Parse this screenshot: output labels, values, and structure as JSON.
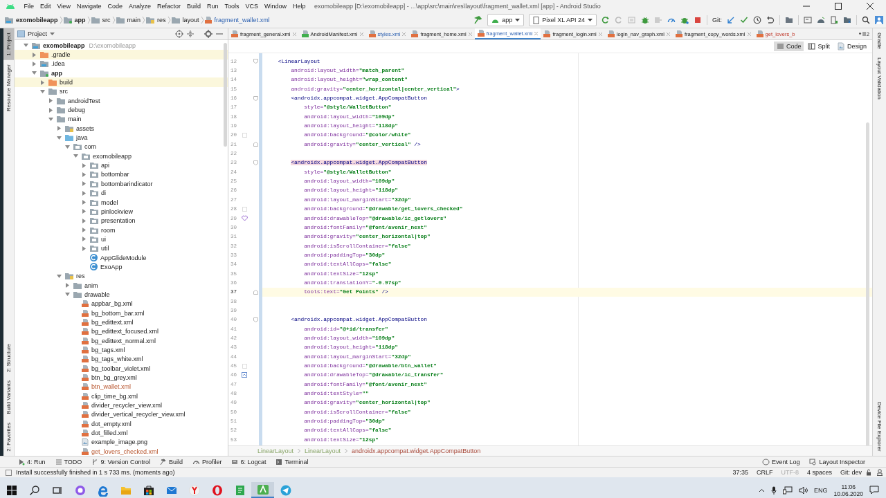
{
  "window": {
    "title": "exomobileapp [D:\\exomobileapp] - ...\\app\\src\\main\\res\\layout\\fragment_wallet.xml [app] - Android Studio"
  },
  "menu": [
    "File",
    "Edit",
    "View",
    "Navigate",
    "Code",
    "Analyze",
    "Refactor",
    "Build",
    "Run",
    "Tools",
    "VCS",
    "Window",
    "Help"
  ],
  "breadcrumbs": [
    {
      "label": "exomobileapp",
      "kind": "module"
    },
    {
      "label": "app",
      "kind": "app"
    },
    {
      "label": "src",
      "kind": "folder"
    },
    {
      "label": "main",
      "kind": "folder"
    },
    {
      "label": "res",
      "kind": "res"
    },
    {
      "label": "layout",
      "kind": "folder"
    },
    {
      "label": "fragment_wallet.xml",
      "kind": "xml"
    }
  ],
  "toolbar": {
    "run_config": "app",
    "device": "Pixel XL API 24",
    "git_label": "Git:"
  },
  "left_strip": {
    "top": [
      {
        "label": "1: Project",
        "selected": true
      },
      {
        "label": "Resource Manager",
        "selected": false
      }
    ],
    "bottom": [
      {
        "label": "2: Structure",
        "selected": false
      },
      {
        "label": "Build Variants",
        "selected": false
      },
      {
        "label": "2: Favorites",
        "selected": false
      }
    ]
  },
  "right_strip": {
    "top": [
      {
        "label": "Gradle"
      },
      {
        "label": "Layout Validation"
      }
    ],
    "bottom": [
      {
        "label": "Device File Explorer"
      }
    ]
  },
  "project_panel": {
    "title": "Project"
  },
  "project_tree": [
    {
      "label": "exomobileapp",
      "path": "D:\\exomobileapp",
      "kind": "module",
      "expanded": true,
      "children": [
        {
          "label": ".gradle",
          "kind": "excluded",
          "expanded": false
        },
        {
          "label": ".idea",
          "kind": "module",
          "expanded": false
        },
        {
          "label": "app",
          "kind": "app",
          "expanded": true,
          "children": [
            {
              "label": "build",
              "kind": "excluded",
              "expanded": false
            },
            {
              "label": "src",
              "kind": "folder",
              "expanded": true,
              "children": [
                {
                  "label": "androidTest",
                  "kind": "folder",
                  "expanded": false
                },
                {
                  "label": "debug",
                  "kind": "folder",
                  "expanded": false
                },
                {
                  "label": "main",
                  "kind": "folder",
                  "expanded": true,
                  "children": [
                    {
                      "label": "assets",
                      "kind": "res",
                      "expanded": false
                    },
                    {
                      "label": "java",
                      "kind": "source",
                      "expanded": true,
                      "children": [
                        {
                          "label": "com",
                          "kind": "package",
                          "expanded": true,
                          "children": [
                            {
                              "label": "exomobileapp",
                              "kind": "package",
                              "expanded": true,
                              "children": [
                                {
                                  "label": "api",
                                  "kind": "package",
                                  "expanded": false
                                },
                                {
                                  "label": "bottombar",
                                  "kind": "package",
                                  "expanded": false
                                },
                                {
                                  "label": "bottombarindicator",
                                  "kind": "package",
                                  "expanded": false
                                },
                                {
                                  "label": "di",
                                  "kind": "package",
                                  "expanded": false
                                },
                                {
                                  "label": "model",
                                  "kind": "package",
                                  "expanded": false
                                },
                                {
                                  "label": "pinlockview",
                                  "kind": "package",
                                  "expanded": false
                                },
                                {
                                  "label": "presentation",
                                  "kind": "package",
                                  "expanded": false
                                },
                                {
                                  "label": "room",
                                  "kind": "package",
                                  "expanded": false
                                },
                                {
                                  "label": "ui",
                                  "kind": "package",
                                  "expanded": false
                                },
                                {
                                  "label": "util",
                                  "kind": "package",
                                  "expanded": false
                                },
                                {
                                  "label": "AppGlideModule",
                                  "kind": "class"
                                },
                                {
                                  "label": "ExoApp",
                                  "kind": "class"
                                }
                              ]
                            }
                          ]
                        }
                      ]
                    },
                    {
                      "label": "res",
                      "kind": "res",
                      "expanded": true,
                      "children": [
                        {
                          "label": "anim",
                          "kind": "folder",
                          "expanded": false
                        },
                        {
                          "label": "drawable",
                          "kind": "folder",
                          "expanded": true,
                          "children": [
                            {
                              "label": "appbar_bg.xml",
                              "kind": "xml",
                              "changed": false
                            },
                            {
                              "label": "bg_bottom_bar.xml",
                              "kind": "xml",
                              "changed": false
                            },
                            {
                              "label": "bg_edittext.xml",
                              "kind": "xml",
                              "changed": false
                            },
                            {
                              "label": "bg_edittext_focused.xml",
                              "kind": "xml",
                              "changed": false
                            },
                            {
                              "label": "bg_edittext_normal.xml",
                              "kind": "xml",
                              "changed": false
                            },
                            {
                              "label": "bg_tags.xml",
                              "kind": "xml",
                              "changed": false
                            },
                            {
                              "label": "bg_tags_white.xml",
                              "kind": "xml",
                              "changed": false
                            },
                            {
                              "label": "bg_toolbar_violet.xml",
                              "kind": "xml",
                              "changed": false
                            },
                            {
                              "label": "btn_bg_grey.xml",
                              "kind": "xml",
                              "changed": false
                            },
                            {
                              "label": "btn_wallet.xml",
                              "kind": "xml",
                              "changed": true
                            },
                            {
                              "label": "clip_time_bg.xml",
                              "kind": "xml",
                              "changed": false
                            },
                            {
                              "label": "divider_recycler_view.xml",
                              "kind": "xml",
                              "changed": false
                            },
                            {
                              "label": "divider_vertical_recycler_view.xml",
                              "kind": "xml",
                              "changed": false
                            },
                            {
                              "label": "dot_empty.xml",
                              "kind": "xml",
                              "changed": false
                            },
                            {
                              "label": "dot_filled.xml",
                              "kind": "xml",
                              "changed": false
                            },
                            {
                              "label": "example_image.png",
                              "kind": "image",
                              "changed": false
                            },
                            {
                              "label": "get_lovers_checked.xml",
                              "kind": "xml",
                              "changed": true
                            }
                          ]
                        }
                      ]
                    }
                  ]
                }
              ]
            }
          ]
        }
      ]
    }
  ],
  "tabs": [
    {
      "label": "fragment_general.xml",
      "kind": "xml",
      "selected": false,
      "modified": false,
      "unversioned": false,
      "closable": true
    },
    {
      "label": "AndroidManifest.xml",
      "kind": "manifest",
      "selected": false,
      "modified": false,
      "unversioned": false,
      "closable": true
    },
    {
      "label": "styles.xml",
      "kind": "xml",
      "selected": false,
      "modified": true,
      "unversioned": false,
      "closable": true
    },
    {
      "label": "fragment_home.xml",
      "kind": "xml",
      "selected": false,
      "modified": false,
      "unversioned": false,
      "closable": true
    },
    {
      "label": "fragment_wallet.xml",
      "kind": "xml",
      "selected": true,
      "modified": true,
      "unversioned": false,
      "closable": true
    },
    {
      "label": "fragment_login.xml",
      "kind": "xml",
      "selected": false,
      "modified": false,
      "unversioned": false,
      "closable": true
    },
    {
      "label": "login_nav_graph.xml",
      "kind": "xml",
      "selected": false,
      "modified": false,
      "unversioned": false,
      "closable": true
    },
    {
      "label": "fragment_copy_words.xml",
      "kind": "xml",
      "selected": false,
      "modified": false,
      "unversioned": false,
      "closable": true
    },
    {
      "label": "get_lovers_b",
      "kind": "xml",
      "selected": false,
      "modified": false,
      "unversioned": true,
      "closable": false
    }
  ],
  "tabs_overflow": "2",
  "view_modes": [
    {
      "label": "Code",
      "kind": "lines",
      "selected": true
    },
    {
      "label": "Split",
      "kind": "split",
      "selected": false
    },
    {
      "label": "Design",
      "kind": "image",
      "selected": false
    }
  ],
  "code": [
    {
      "n": "12",
      "current": false,
      "kind": "fold-start",
      "tokens": [
        {
          "kind": "tag",
          "text": "<LinearLayout"
        }
      ],
      "children": [
        {
          "n": "13",
          "current": false,
          "kind": "plain",
          "tokens": [
            {
              "kind": "attr",
              "text": "android:layout_width="
            },
            {
              "kind": "val",
              "text": "\"match_parent\""
            }
          ]
        },
        {
          "n": "14",
          "current": false,
          "kind": "plain",
          "tokens": [
            {
              "kind": "attr",
              "text": "android:layout_height="
            },
            {
              "kind": "val",
              "text": "\"wrap_content\""
            }
          ]
        },
        {
          "n": "15",
          "current": false,
          "kind": "plain",
          "tokens": [
            {
              "kind": "attr",
              "text": "android:gravity="
            },
            {
              "kind": "val",
              "text": "\"center_horizontal|center_vertical\""
            },
            {
              "kind": "tag",
              "text": ">"
            }
          ]
        },
        {
          "n": "16",
          "current": false,
          "kind": "fold-start",
          "tokens": [
            {
              "kind": "tag",
              "text": "<androidx.appcompat.widget.AppCompatButton"
            }
          ],
          "children": [
            {
              "n": "17",
              "current": false,
              "kind": "plain",
              "tokens": [
                {
                  "kind": "attr",
                  "text": "style="
                },
                {
                  "kind": "val",
                  "text": "\"@style/WalletButton\""
                }
              ]
            },
            {
              "n": "18",
              "current": false,
              "kind": "plain",
              "tokens": [
                {
                  "kind": "attr",
                  "text": "android:layout_width="
                },
                {
                  "kind": "val",
                  "text": "\"109dp\""
                }
              ]
            },
            {
              "n": "19",
              "current": false,
              "kind": "plain",
              "tokens": [
                {
                  "kind": "attr",
                  "text": "android:layout_height="
                },
                {
                  "kind": "val",
                  "text": "\"118dp\""
                }
              ]
            },
            {
              "n": "20",
              "current": false,
              "kind": "swatch",
              "tokens": [
                {
                  "kind": "attr",
                  "text": "android:background="
                },
                {
                  "kind": "val",
                  "text": "\"@color/white\""
                }
              ]
            },
            {
              "n": "21",
              "current": false,
              "kind": "fold-end",
              "tokens": [
                {
                  "kind": "attr",
                  "text": "android:gravity="
                },
                {
                  "kind": "val",
                  "text": "\"center_vertical\""
                },
                {
                  "kind": "tag",
                  "text": " />"
                }
              ]
            }
          ]
        },
        {
          "n": "22",
          "current": false,
          "kind": "plain"
        },
        {
          "n": "23",
          "current": false,
          "kind": "fold-start",
          "tokens": [
            {
              "kind": "match",
              "text": "<androidx.appcompat.widget.AppCompatButton"
            }
          ],
          "children": [
            {
              "n": "24",
              "current": false,
              "kind": "plain",
              "tokens": [
                {
                  "kind": "attr",
                  "text": "style="
                },
                {
                  "kind": "val",
                  "text": "\"@style/WalletButton\""
                }
              ]
            },
            {
              "n": "25",
              "current": false,
              "kind": "plain",
              "tokens": [
                {
                  "kind": "attr",
                  "text": "android:layout_width="
                },
                {
                  "kind": "val",
                  "text": "\"109dp\""
                }
              ]
            },
            {
              "n": "26",
              "current": false,
              "kind": "plain",
              "tokens": [
                {
                  "kind": "attr",
                  "text": "android:layout_height="
                },
                {
                  "kind": "val",
                  "text": "\"118dp\""
                }
              ]
            },
            {
              "n": "27",
              "current": false,
              "kind": "plain",
              "tokens": [
                {
                  "kind": "attr",
                  "text": "android:layout_marginStart="
                },
                {
                  "kind": "val",
                  "text": "\"32dp\""
                }
              ]
            },
            {
              "n": "28",
              "current": false,
              "kind": "swatch",
              "tokens": [
                {
                  "kind": "attr",
                  "text": "android:background="
                },
                {
                  "kind": "val",
                  "text": "\"@drawable/get_lovers_checked\""
                }
              ]
            },
            {
              "n": "29",
              "current": false,
              "kind": "heart",
              "tokens": [
                {
                  "kind": "attr",
                  "text": "android:drawableTop="
                },
                {
                  "kind": "val",
                  "text": "\"@drawable/ic_getlovers\""
                }
              ]
            },
            {
              "n": "30",
              "current": false,
              "kind": "plain",
              "tokens": [
                {
                  "kind": "attr",
                  "text": "android:fontFamily="
                },
                {
                  "kind": "val",
                  "text": "\"@font/avenir_next\""
                }
              ]
            },
            {
              "n": "31",
              "current": false,
              "kind": "plain",
              "tokens": [
                {
                  "kind": "attr",
                  "text": "android:gravity="
                },
                {
                  "kind": "val",
                  "text": "\"center_horizontal|top\""
                }
              ]
            },
            {
              "n": "32",
              "current": false,
              "kind": "plain",
              "tokens": [
                {
                  "kind": "attr",
                  "text": "android:isScrollContainer="
                },
                {
                  "kind": "val",
                  "text": "\"false\""
                }
              ]
            },
            {
              "n": "33",
              "current": false,
              "kind": "plain",
              "tokens": [
                {
                  "kind": "attr",
                  "text": "android:paddingTop="
                },
                {
                  "kind": "val",
                  "text": "\"30dp\""
                }
              ]
            },
            {
              "n": "34",
              "current": false,
              "kind": "plain",
              "tokens": [
                {
                  "kind": "attr",
                  "text": "android:textAllCaps="
                },
                {
                  "kind": "val",
                  "text": "\"false\""
                }
              ]
            },
            {
              "n": "35",
              "current": false,
              "kind": "plain",
              "tokens": [
                {
                  "kind": "attr",
                  "text": "android:textSize="
                },
                {
                  "kind": "val",
                  "text": "\"12sp\""
                }
              ]
            },
            {
              "n": "36",
              "current": false,
              "kind": "plain",
              "tokens": [
                {
                  "kind": "attr",
                  "text": "android:translationY="
                },
                {
                  "kind": "val",
                  "text": "\"-0.97sp\""
                }
              ]
            },
            {
              "n": "37",
              "current": true,
              "kind": "fold-end",
              "tokens": [
                {
                  "kind": "attr",
                  "text": "tools:text="
                },
                {
                  "kind": "val",
                  "text": "\"Get Points\""
                },
                {
                  "kind": "tag",
                  "text": " />"
                }
              ]
            }
          ]
        },
        {
          "n": "38",
          "current": false,
          "kind": "plain"
        },
        {
          "n": "39",
          "current": false,
          "kind": "plain"
        },
        {
          "n": "40",
          "current": false,
          "kind": "fold-start",
          "tokens": [
            {
              "kind": "tag",
              "text": "<androidx.appcompat.widget.AppCompatButton"
            }
          ],
          "children": [
            {
              "n": "41",
              "current": false,
              "kind": "plain",
              "tokens": [
                {
                  "kind": "attr",
                  "text": "android:id="
                },
                {
                  "kind": "val",
                  "text": "\"@+id/transfer\""
                }
              ]
            },
            {
              "n": "42",
              "current": false,
              "kind": "plain",
              "tokens": [
                {
                  "kind": "attr",
                  "text": "android:layout_width="
                },
                {
                  "kind": "val",
                  "text": "\"109dp\""
                }
              ]
            },
            {
              "n": "43",
              "current": false,
              "kind": "plain",
              "tokens": [
                {
                  "kind": "attr",
                  "text": "android:layout_height="
                },
                {
                  "kind": "val",
                  "text": "\"118dp\""
                }
              ]
            },
            {
              "n": "44",
              "current": false,
              "kind": "plain",
              "tokens": [
                {
                  "kind": "attr",
                  "text": "android:layout_marginStart="
                },
                {
                  "kind": "val",
                  "text": "\"32dp\""
                }
              ]
            },
            {
              "n": "45",
              "current": false,
              "kind": "swatch",
              "tokens": [
                {
                  "kind": "attr",
                  "text": "android:background="
                },
                {
                  "kind": "val",
                  "text": "\"@drawable/btn_wallet\""
                }
              ]
            },
            {
              "n": "46",
              "current": false,
              "kind": "image",
              "tokens": [
                {
                  "kind": "attr",
                  "text": "android:drawableTop="
                },
                {
                  "kind": "val",
                  "text": "\"@drawable/ic_transfer\""
                }
              ]
            },
            {
              "n": "47",
              "current": false,
              "kind": "plain",
              "tokens": [
                {
                  "kind": "attr",
                  "text": "android:fontFamily="
                },
                {
                  "kind": "val",
                  "text": "\"@font/avenir_next\""
                }
              ]
            },
            {
              "n": "48",
              "current": false,
              "kind": "plain",
              "tokens": [
                {
                  "kind": "attr",
                  "text": "android:textStyle="
                },
                {
                  "kind": "val",
                  "text": "\"\""
                }
              ]
            },
            {
              "n": "49",
              "current": false,
              "kind": "plain",
              "tokens": [
                {
                  "kind": "attr",
                  "text": "android:gravity="
                },
                {
                  "kind": "val",
                  "text": "\"center_horizontal|top\""
                }
              ]
            },
            {
              "n": "50",
              "current": false,
              "kind": "plain",
              "tokens": [
                {
                  "kind": "attr",
                  "text": "android:isScrollContainer="
                },
                {
                  "kind": "val",
                  "text": "\"false\""
                }
              ]
            },
            {
              "n": "51",
              "current": false,
              "kind": "plain",
              "tokens": [
                {
                  "kind": "attr",
                  "text": "android:paddingTop="
                },
                {
                  "kind": "val",
                  "text": "\"30dp\""
                }
              ]
            },
            {
              "n": "52",
              "current": false,
              "kind": "plain",
              "tokens": [
                {
                  "kind": "attr",
                  "text": "android:textAllCaps="
                },
                {
                  "kind": "val",
                  "text": "\"false\""
                }
              ]
            },
            {
              "n": "53",
              "current": false,
              "kind": "plain",
              "tokens": [
                {
                  "kind": "attr",
                  "text": "android:textSize="
                },
                {
                  "kind": "val",
                  "text": "\"12sp\""
                }
              ]
            }
          ]
        }
      ]
    }
  ],
  "editor_path": [
    {
      "label": "LinearLayout",
      "selected": false
    },
    {
      "label": "LinearLayout",
      "selected": false
    },
    {
      "label": "androidx.appcompat.widget.AppCompatButton",
      "selected": true
    }
  ],
  "tool_windows": {
    "left": [
      {
        "label": "4: Run",
        "kind": "run"
      },
      {
        "label": "TODO",
        "kind": "list"
      },
      {
        "label": "9: Version Control",
        "kind": "branch"
      },
      {
        "label": "Build",
        "kind": "hammer"
      },
      {
        "label": "Profiler",
        "kind": "gauge"
      },
      {
        "label": "6: Logcat",
        "kind": "log"
      },
      {
        "label": "Terminal",
        "kind": "terminal"
      }
    ],
    "right": [
      {
        "label": "Event Log",
        "kind": "balloon"
      },
      {
        "label": "Layout Inspector",
        "kind": "inspect"
      }
    ]
  },
  "status_bar": {
    "message": "Install successfully finished in 1 s 733 ms. (moments ago)",
    "items": [
      {
        "label": "37:35",
        "disabled": false
      },
      {
        "label": "CRLF",
        "disabled": false
      },
      {
        "label": "UTF-8",
        "disabled": true
      },
      {
        "label": "4 spaces",
        "disabled": false
      },
      {
        "label": "Git: dev",
        "disabled": false
      }
    ]
  },
  "taskbar": {
    "apps": [
      {
        "kind": "search",
        "selected": false
      },
      {
        "kind": "taskview",
        "selected": false
      },
      {
        "kind": "ring",
        "selected": false
      },
      {
        "kind": "browser",
        "selected": false
      },
      {
        "kind": "folder",
        "selected": false
      },
      {
        "kind": "bag",
        "selected": false
      },
      {
        "kind": "mail",
        "selected": false
      },
      {
        "kind": "yring",
        "selected": false
      },
      {
        "kind": "oring",
        "selected": false
      },
      {
        "kind": "note",
        "selected": false
      },
      {
        "kind": "android",
        "selected": true
      },
      {
        "kind": "plane",
        "selected": false
      }
    ],
    "language": "ENG",
    "time": "11:06",
    "date": "10.06.2020"
  }
}
